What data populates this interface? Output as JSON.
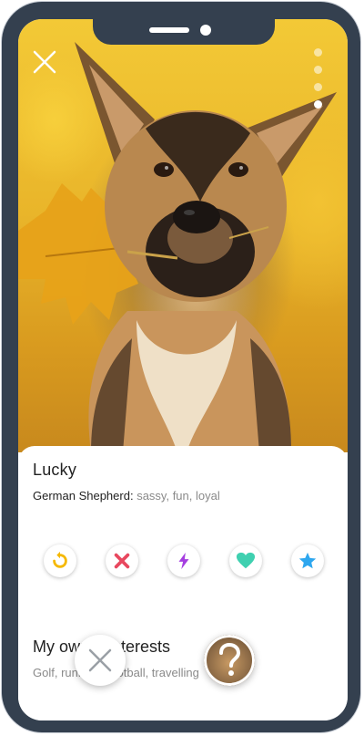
{
  "profile": {
    "name": "Lucky",
    "breed_label": "German Shepherd:",
    "traits": "sassy, fun, loyal",
    "photo_subject": "german-shepherd-with-autumn-leaf"
  },
  "photo_nav": {
    "pages": 4,
    "active_page": 4
  },
  "actions": {
    "items": [
      {
        "name": "rewind",
        "icon": "rewind-icon",
        "color": "#f5b800"
      },
      {
        "name": "nope",
        "icon": "x-icon",
        "color": "#e8485f"
      },
      {
        "name": "boost",
        "icon": "lightning-icon",
        "color": "#a53ee0"
      },
      {
        "name": "like",
        "icon": "heart-icon",
        "color": "#3fd0b0"
      },
      {
        "name": "super-like",
        "icon": "star-icon",
        "color": "#2ea7ef"
      }
    ]
  },
  "owner": {
    "section_title": "My owner interests",
    "interests": "Golf, running, football, travelling"
  },
  "colors": {
    "frame": "#34404f",
    "text_primary": "#222222",
    "text_secondary": "#8a8a8a"
  }
}
